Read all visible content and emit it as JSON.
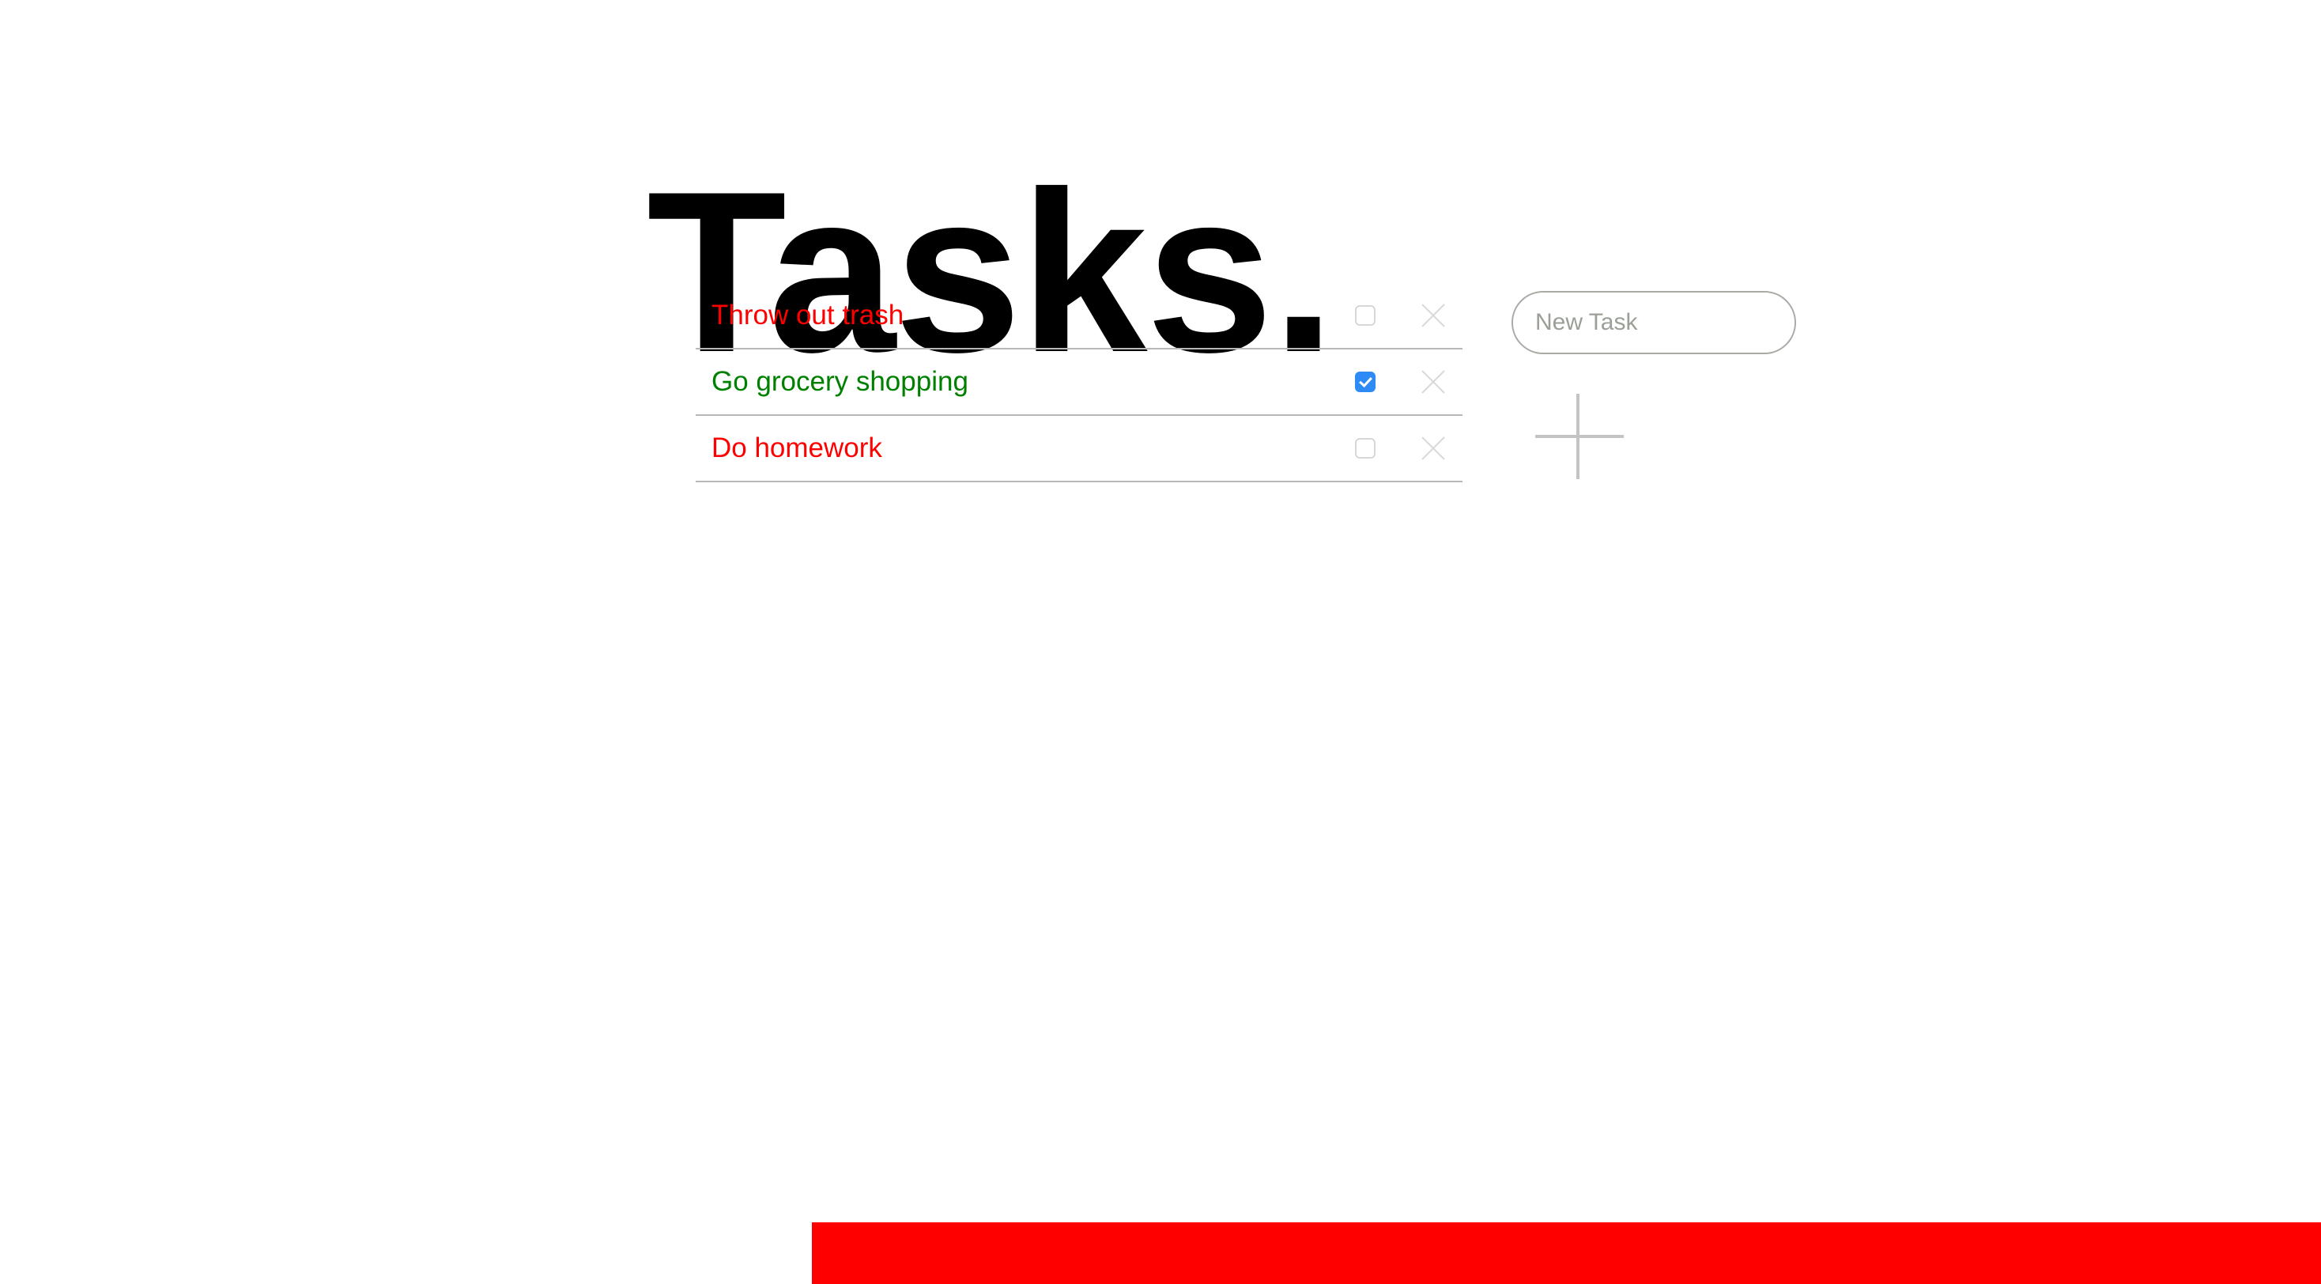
{
  "app": {
    "title": "Tasks.",
    "background_color": "#ffffff"
  },
  "colors": {
    "pending_task": "#ff0000",
    "completed_task": "#008000",
    "checkbox_checked": "#2e8bf5",
    "checkbox_border": "#d7d7d7",
    "divider": "#b8b8b8",
    "delete_icon": "#d9d9d9",
    "input_border": "#a8aba4",
    "placeholder": "#9aa096",
    "add_icon": "#c4c4c4",
    "banner": "#ff0000"
  },
  "task_list": {
    "tasks": [
      {
        "label": "Throw out trash",
        "completed": false,
        "checkbox_icon": "unchecked-checkbox-icon",
        "delete_icon": "close-x-icon"
      },
      {
        "label": "Go grocery shopping",
        "completed": true,
        "checkbox_icon": "checked-checkbox-icon",
        "delete_icon": "close-x-icon"
      },
      {
        "label": "Do homework",
        "completed": false,
        "checkbox_icon": "unchecked-checkbox-icon",
        "delete_icon": "close-x-icon"
      }
    ]
  },
  "new_task": {
    "placeholder": "New Task",
    "value": "",
    "add_button_icon": "plus-icon"
  },
  "banner": {
    "label": ""
  }
}
